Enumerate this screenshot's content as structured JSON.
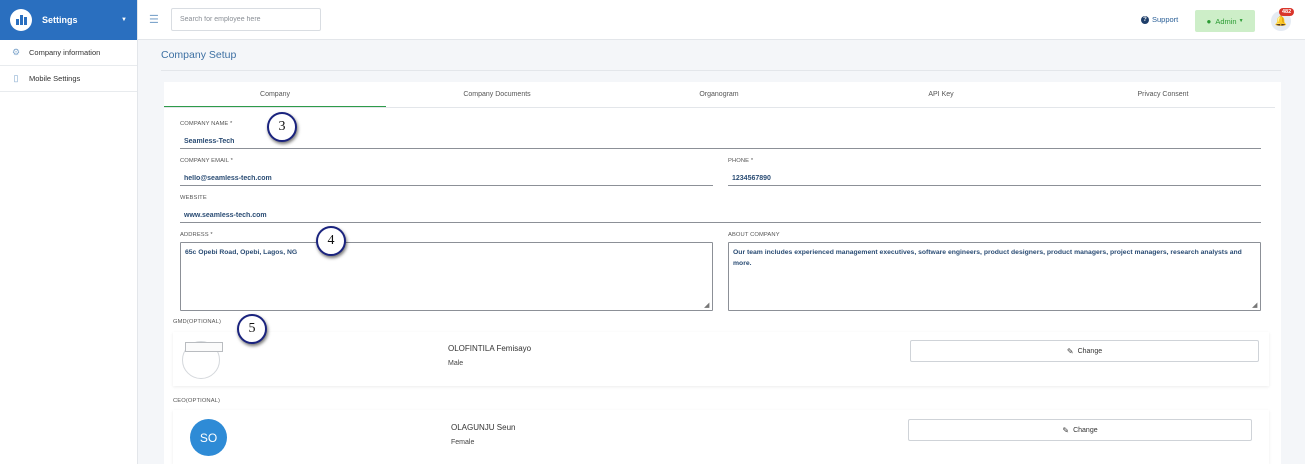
{
  "sidebar": {
    "title": "Settings",
    "items": [
      {
        "label": "Company information",
        "icon": "gear-icon"
      },
      {
        "label": "Mobile Settings",
        "icon": "mobile-icon"
      }
    ]
  },
  "topbar": {
    "search_placeholder": "Search for employee here",
    "support_label": "Support",
    "admin_label": "Admin",
    "notification_count": "482"
  },
  "page": {
    "title": "Company Setup"
  },
  "tabs": [
    {
      "label": "Company",
      "active": true
    },
    {
      "label": "Company Documents",
      "active": false
    },
    {
      "label": "Organogram",
      "active": false
    },
    {
      "label": "API Key",
      "active": false
    },
    {
      "label": "Privacy Consent",
      "active": false
    }
  ],
  "form": {
    "company_name": {
      "label": "COMPANY NAME *",
      "value": "Seamless-Tech"
    },
    "company_email": {
      "label": "COMPANY EMAIL *",
      "value": "hello@seamless-tech.com"
    },
    "phone": {
      "label": "PHONE *",
      "value": "1234567890"
    },
    "website": {
      "label": "WEBSITE",
      "value": "www.seamless-tech.com"
    },
    "address": {
      "label": "ADDRESS *",
      "value": "65c Opebi Road, Opebi, Lagos, NG"
    },
    "about": {
      "label": "ABOUT COMPANY",
      "value": "Our team includes experienced management executives, software engineers, product designers, product managers, project managers, research analysts and more."
    }
  },
  "gmd": {
    "label": "GMD(OPTIONAL)",
    "name": "OLOFINTILA Femisayo",
    "gender": "Male",
    "change_label": "Change"
  },
  "ceo": {
    "label": "CEO(OPTIONAL)",
    "initials": "SO",
    "name": "OLAGUNJU Seun",
    "gender": "Female",
    "change_label": "Change"
  },
  "annotations": [
    "3",
    "4",
    "5"
  ],
  "colors": {
    "brand": "#2a6fbf",
    "accent_green": "#2e9b4a",
    "admin_bg": "#cdeec8",
    "badge_red": "#d9352b"
  }
}
